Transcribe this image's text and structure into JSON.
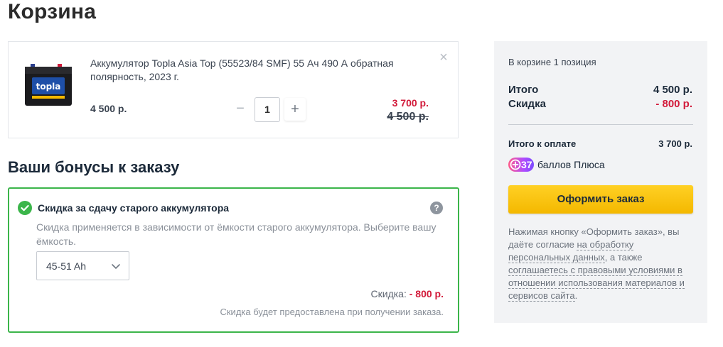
{
  "page": {
    "title": "Корзина"
  },
  "cart_item": {
    "name": "Аккумулятор Topla Asia Top (55523/84 SMF) 55 Ач 490 А обратная полярность, 2023 г.",
    "unit_price": "4 500 р.",
    "quantity": "1",
    "qty_minus": "−",
    "qty_plus": "+",
    "remove": "×",
    "new_price": "3 700 р.",
    "old_price": "4 500 р."
  },
  "bonus": {
    "section_title": "Ваши бонусы к заказу",
    "heading": "Скидка за сдачу старого аккумулятора",
    "help": "?",
    "description": "Скидка применяется в зависимости от ёмкости старого аккумулятора. Выберите вашу ёмкость.",
    "capacity_selected": "45-51 Ah",
    "discount_label": "Скидка:",
    "discount_value": "- 800 р.",
    "note": "Скидка будет предоставлена при получении заказа."
  },
  "summary": {
    "items_count": "В корзине 1 позиция",
    "total_label": "Итого",
    "total_value": "4 500 р.",
    "discount_label": "Скидка",
    "discount_value": "- 800 р.",
    "pay_label": "Итого к оплате",
    "pay_value": "3 700 р.",
    "plus_points": "37",
    "plus_text": "баллов Плюса",
    "order_button": "Оформить заказ",
    "consent_prefix": "Нажимая кнопку «Оформить заказ», вы даёте согласие ",
    "consent_link1": "на обработку персональных данных",
    "consent_middle": ", а также ",
    "consent_link2": "соглашаетесь с правовыми условиями в отношении использования материалов и сервисов сайта",
    "consent_suffix": "."
  },
  "colors": {
    "accent_red": "#d21a3a",
    "success_green": "#3bb54a",
    "button_yellow": "#ffd024"
  },
  "icons": [
    "battery-product-image",
    "close-icon",
    "check-circle-icon",
    "help-icon",
    "chevron-down-icon",
    "plus-logo-icon"
  ]
}
